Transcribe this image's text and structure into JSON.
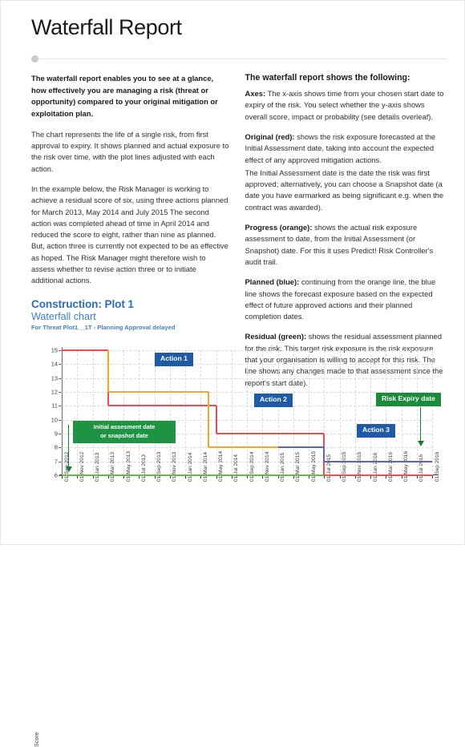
{
  "page": {
    "title": "Waterfall Report"
  },
  "left_column": {
    "lead": "The waterfall report enables you to see at a glance, how effectively you are managing a risk (threat or opportunity) compared to your original mitigation or exploitation plan.",
    "para_2": "The chart represents the life of a single risk, from first approval to expiry. It shows planned and actual exposure to the risk over time, with the plot lines adjusted with each action.",
    "para_3": "In the example below, the Risk Manager is working to achieve a residual score of six, using three actions planned for March 2013, May 2014 and July 2015 The second action was completed ahead of time in April 2014 and reduced the score to eight, rather than nine as planned. But, action three is currently not expected to be as effective as hoped. The Risk Manager might therefore wish to assess whether to revise action three or to initiate additional actions."
  },
  "right_column": {
    "heading": "The waterfall report shows the following:",
    "items": [
      {
        "term": "Axes:",
        "text": " The x-axis shows time from your chosen start date to expiry of the risk. You select whether the y-axis shows overall score, impact or probability (see details overleaf)."
      },
      {
        "term": "Original (red):",
        "text": " shows the risk exposure forecasted at the Initial Assessment date, taking into account the expected effect of any approved mitigation actions."
      },
      {
        "term": "",
        "text": "The Initial Assessment date is the date the risk was first approved; alternatively, you can choose a Snapshot date (a date you have earmarked as being significant e.g. when the contract was awarded)."
      },
      {
        "term": "Progress (orange):",
        "text": " shows the actual risk exposure assessment to date, from the Initial Assessment (or Snapshot) date. For this it uses Predict! Risk Controller's audit trail."
      },
      {
        "term": "Planned (blue):",
        "text": " continuing from the orange line, the blue line shows the forecast exposure based on the expected effect of future approved actions and their planned completion dates."
      },
      {
        "term": "Residual (green):",
        "text": " shows the residual assessment planned for the risk. This target risk exposure is the risk exposure that your organisation is willing to accept for this risk. The line shows any changes made to that assessment since the report's start date)."
      }
    ]
  },
  "chart_header": {
    "line1": "Construction: Plot 1",
    "line2": "Waterfall chart",
    "line3": "For Threat Plot1__1T - Planning Approval delayed"
  },
  "chart_data": {
    "type": "line",
    "title": "Waterfall chart",
    "xlabel": "",
    "ylabel": "Score",
    "ylim": [
      6,
      15
    ],
    "yticks": [
      6,
      7,
      8,
      9,
      10,
      11,
      12,
      13,
      14,
      15
    ],
    "grid": true,
    "legend_position": "none",
    "x_tick_labels": [
      "01 Sep 2012",
      "01 Nov 2012",
      "01 Jan 2013",
      "01 Mar 2013",
      "01 May 2013",
      "01 Jul 2013",
      "01 Sep 2013",
      "01 Nov 2013",
      "01 Jan 2014",
      "01 Mar 2014",
      "01 May 2014",
      "01 Jul 2014",
      "01 Sep 2014",
      "01 Nov 2014",
      "01 Jan 2015",
      "01 Mar 2015",
      "01 May 2015",
      "01 Jul 2015",
      "01 Sep 2015",
      "01 Nov 2015",
      "01 Jan 2016",
      "01 Mar 2016",
      "01 May 2016",
      "01 Jul 2016",
      "01 Sep 2016"
    ],
    "xlim": [
      "01 Sep 2012",
      "01 Sep 2016"
    ],
    "series": [
      {
        "name": "Original (red)",
        "color": "#ef4b51",
        "steps": [
          {
            "x": "01 Sep 2012",
            "y": 15
          },
          {
            "x": "01 Mar 2013",
            "y": 11
          },
          {
            "x": "01 May 2014",
            "y": 9
          },
          {
            "x": "01 Jul 2015",
            "y": 6
          },
          {
            "x": "01 Sep 2016",
            "y": 6
          }
        ]
      },
      {
        "name": "Progress (orange)",
        "color": "#f6a623",
        "steps": [
          {
            "x": "01 Mar 2013",
            "y": 15
          },
          {
            "x": "01 Mar 2013",
            "y": 12
          },
          {
            "x": "01 Apr 2014",
            "y": 8
          },
          {
            "x": "01 Jan 2015",
            "y": 8
          }
        ]
      },
      {
        "name": "Planned (blue)",
        "color": "#5b65b8",
        "steps": [
          {
            "x": "01 Jan 2015",
            "y": 8
          },
          {
            "x": "01 Jul 2015",
            "y": 8
          },
          {
            "x": "01 Jul 2015",
            "y": 7
          },
          {
            "x": "01 Sep 2016",
            "y": 7
          }
        ]
      },
      {
        "name": "Residual (green)",
        "color": "#62bb46",
        "steps": [
          {
            "x": "01 Sep 2012",
            "y": 6
          },
          {
            "x": "01 Jul 2015",
            "y": 6
          }
        ]
      }
    ],
    "annotations": [
      {
        "label": "Action 1",
        "style": "blue-badge"
      },
      {
        "label": "Action 2",
        "style": "blue-badge"
      },
      {
        "label": "Action 3",
        "style": "blue-badge"
      },
      {
        "label": "Risk Expiry date",
        "style": "green-badge-arrow"
      },
      {
        "label": "Initial assesment date\nor snapshot date",
        "line1": "Initial assesment date",
        "line2": "or snapshot date",
        "style": "green-box-arrow"
      }
    ]
  },
  "colors": {
    "accent_blue": "#2a6ebb",
    "badge_blue": "#1f5aa6",
    "green": "#1e9344",
    "red_line": "#ef4b51",
    "orange_line": "#f6a623",
    "blue_line": "#5b65b8",
    "green_line": "#62bb46"
  }
}
